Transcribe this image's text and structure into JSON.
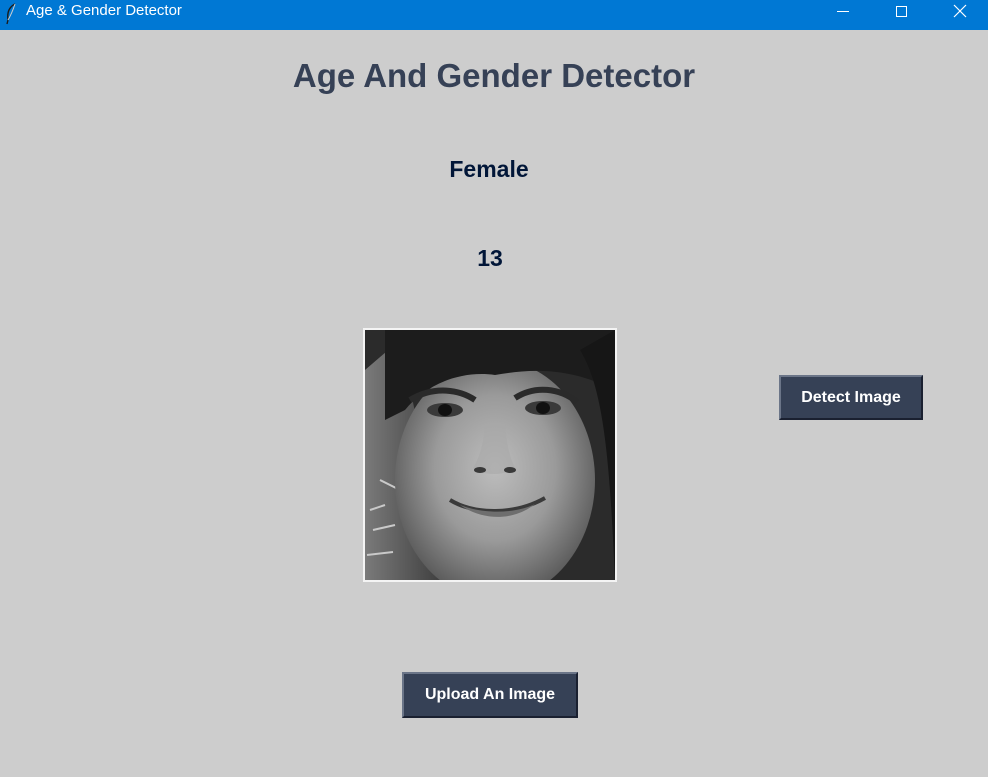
{
  "window": {
    "title": "Age & Gender Detector",
    "icons": {
      "app": "feather-icon",
      "minimize": "minimize-icon",
      "maximize": "maximize-icon",
      "close": "close-icon"
    }
  },
  "main": {
    "heading": "Age And Gender Detector",
    "gender": "Female",
    "age": "13",
    "photo": "grayscale portrait of a smiling young girl"
  },
  "buttons": {
    "detect": "Detect Image",
    "upload": "Upload An Image"
  },
  "colors": {
    "titlebar": "#0078d4",
    "background": "#cdcdcd",
    "heading": "#364156",
    "result_text": "#011638",
    "button_bg": "#364156",
    "button_text": "#ffffff"
  }
}
